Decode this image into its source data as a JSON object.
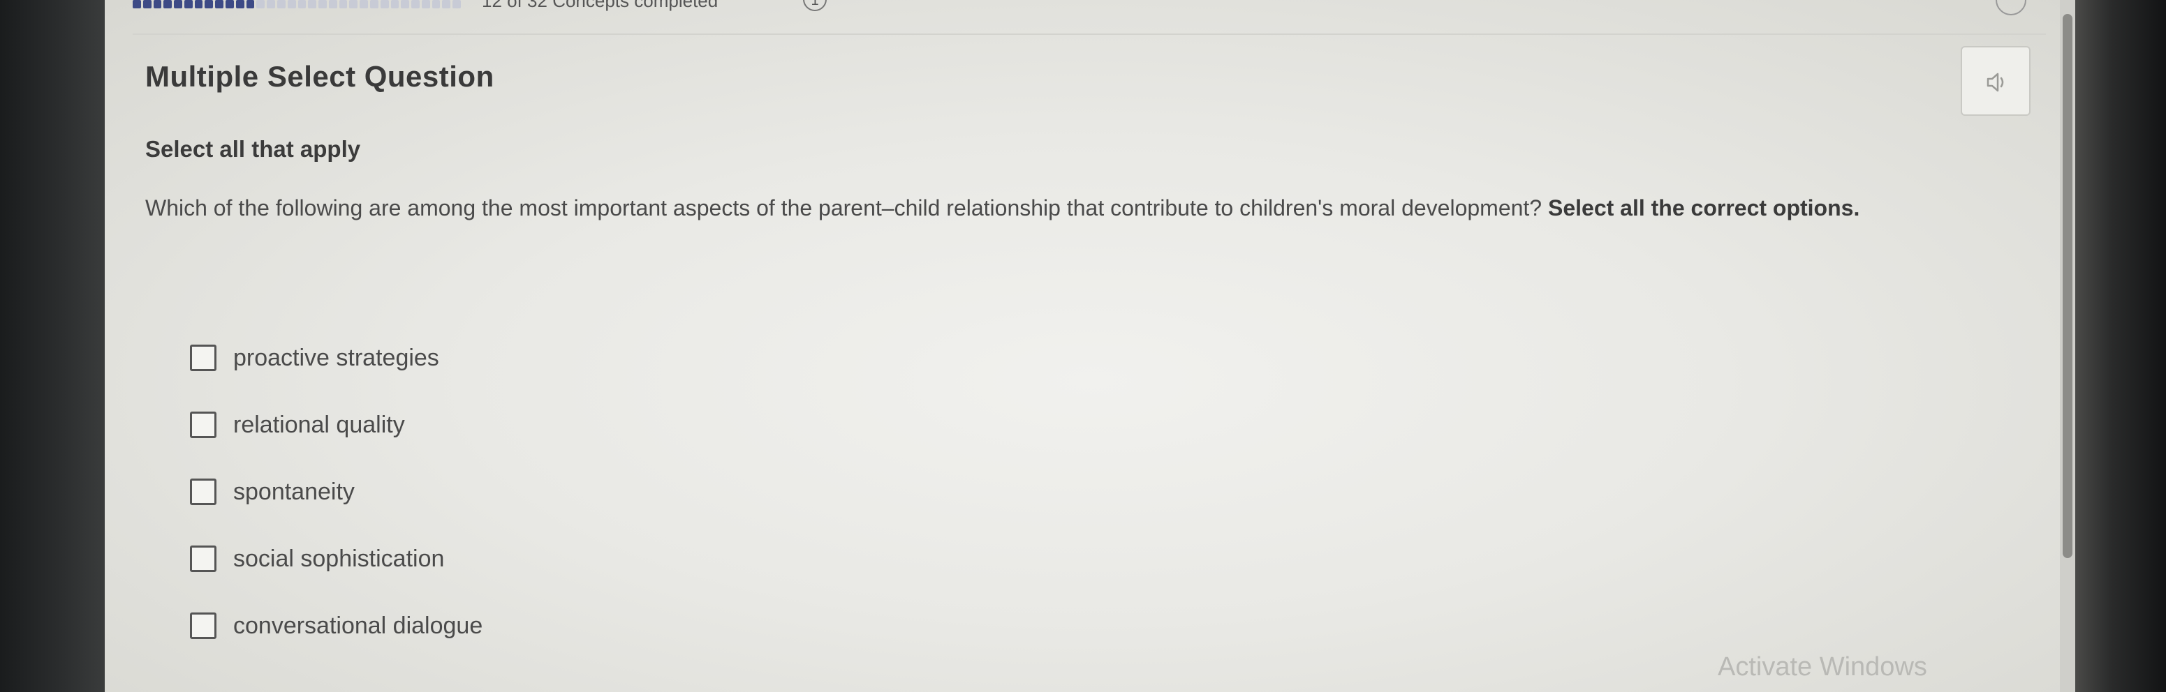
{
  "header": {
    "progress_text": "12 of 32 Concepts completed",
    "info_icon": "1",
    "progress": {
      "completed": 12,
      "total": 32
    }
  },
  "question": {
    "type_label": "Multiple Select Question",
    "instruction": "Select all that apply",
    "prompt": "Which of the following are among the most important aspects of the parent–child relationship that contribute to children's moral development?",
    "prompt_emphasis": "Select all the correct options."
  },
  "options": [
    {
      "label": "proactive strategies",
      "checked": false
    },
    {
      "label": "relational quality",
      "checked": false
    },
    {
      "label": "spontaneity",
      "checked": false
    },
    {
      "label": "social sophistication",
      "checked": false
    },
    {
      "label": "conversational dialogue",
      "checked": false
    }
  ],
  "icons": {
    "audio": "speaker-icon",
    "checkbox": "checkbox-icon"
  },
  "watermark": "Activate Windows",
  "colors": {
    "progress_done": "#3d4a86",
    "progress_remaining": "#c8cbd6"
  }
}
